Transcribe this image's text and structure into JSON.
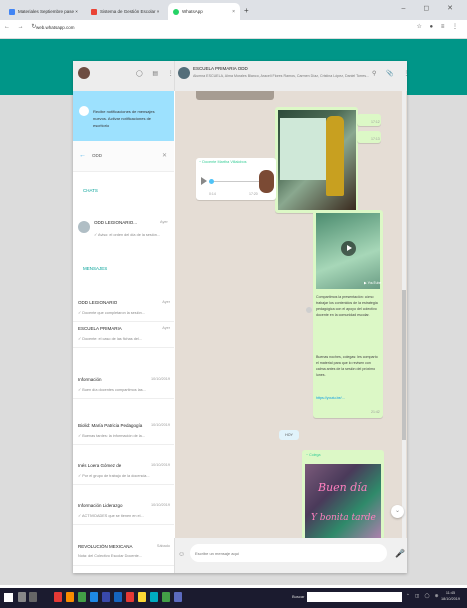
{
  "browser": {
    "tabs": [
      {
        "label": "Materiales Septiembre pase ×"
      },
      {
        "label": "Sistema de Gestión Escolar ×"
      },
      {
        "label": "WhatsApp"
      }
    ],
    "new_tab": "+",
    "window_controls": "–  ◻  ✕",
    "nav_buttons": "←  →  ↻",
    "url": "web.whatsapp.com",
    "extension_icons": "☆ ● ≡ ⋮"
  },
  "sidebar": {
    "header_icons": "◯  ▤  ⋮",
    "notice": "Recibe notificaciones de mensajes nuevos. Activar notificaciones de escritorio",
    "search": {
      "value": "ODD",
      "clear": "✕"
    },
    "chats_label": "CHATS",
    "result_chat": {
      "name": "ODD LEGIONARIO...",
      "time": "Ayer",
      "preview": "✓ Aviso: el orden del día de la sesión..."
    },
    "messages_label": "MENSAJES",
    "chats": [
      {
        "name": "ODD LEGIONARIO",
        "time": "Ayer",
        "preview": "✓ Docente que completaron la sesión..."
      },
      {
        "name": "ESCUELA PRIMARIA",
        "time": "Ayer",
        "preview": "✓ Docente: el caso de las fichas del..."
      },
      {
        "name": "Información",
        "time": "10/10/2019",
        "preview": "✓ Buen día docentes compartimos las..."
      },
      {
        "name": "Biolid: María Patricia Pedagogía",
        "time": "10/10/2019",
        "preview": "✓ Buenas tardes: la información de la..."
      },
      {
        "name": "Inés Loera Gómez de",
        "time": "10/10/2019",
        "preview": "✓ Por el grupo de trabajo de la docencia..."
      },
      {
        "name": "Información Liderazgo",
        "time": "10/10/2019",
        "preview": "✓ ACTIVIDADES que se tienen en el..."
      },
      {
        "name": "REVOLUCIÓN MEXICANA",
        "time": "Sábado",
        "preview": "Nota: del Colectivo Escolar Docente..."
      }
    ]
  },
  "conversation": {
    "name": "ESCUELA PRIMARIA ODD",
    "members": "Alumna ESCUELA, Alma Morales Blanco, Araceli Flores Ramos, Carmen Díaz, Cristina López, Daniel Torres...",
    "header_icons": "⚲  📎  ⋮",
    "side_time_1": "17:12",
    "side_time_2": "17:13",
    "audio": {
      "sender": "~ Docente Martha Villalobos",
      "duration": "0:14",
      "time": "17:20"
    },
    "video": {
      "yt_label": "▶ YouTube",
      "caption_1": "Compartimos la presentación: cómo trabajar los contenidos de la estrategia pedagógica con el apoyo del colectivo docente en la comunidad escolar.",
      "caption_2": "Buenas noches, colegas: les comparto el material para que lo revisen con calma antes de la sesión del próximo lunes.",
      "link": "https://youtu.be/…",
      "time": "21:42"
    },
    "date_chip": "HOY",
    "image_msg": {
      "sender": "~ Colega",
      "line1": "Buen día",
      "line2": "Y bonita tarde"
    },
    "down_button": "⌄",
    "emoji_icon": "☺",
    "input_placeholder": "Escribe un mensaje aquí",
    "mic_icon": "🎤"
  },
  "taskbar": {
    "search_label": "Buscar",
    "tray": "⌃ ◫ ◯ ⊕",
    "time": "11:45",
    "date": "18/10/2019"
  }
}
